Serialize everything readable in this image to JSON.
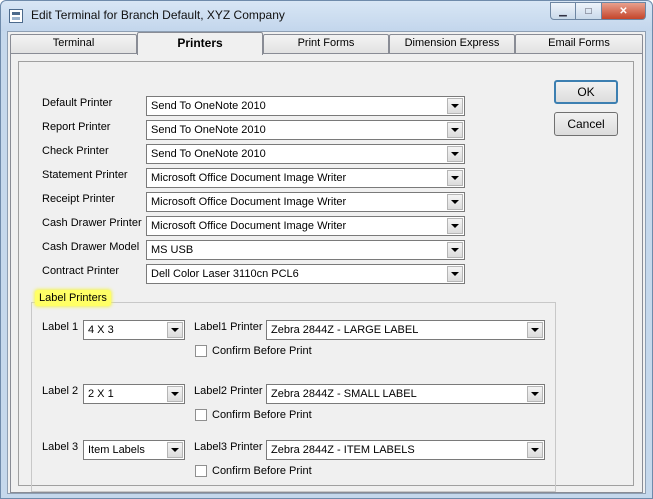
{
  "window": {
    "title": "Edit Terminal  for Branch Default, XYZ Company",
    "minimize_glyph": "▁",
    "maximize_glyph": "□",
    "close_glyph": "✕"
  },
  "tabs": [
    {
      "label": "Terminal"
    },
    {
      "label": "Printers"
    },
    {
      "label": "Print Forms"
    },
    {
      "label": "Dimension Express"
    },
    {
      "label": "Email Forms"
    }
  ],
  "printers": [
    {
      "label": "Default Printer",
      "value": "Send To OneNote 2010"
    },
    {
      "label": "Report Printer",
      "value": "Send To OneNote 2010"
    },
    {
      "label": "Check Printer",
      "value": "Send To OneNote 2010"
    },
    {
      "label": "Statement Printer",
      "value": "Microsoft Office Document Image Writer"
    },
    {
      "label": "Receipt Printer",
      "value": "Microsoft Office Document Image Writer"
    },
    {
      "label": "Cash Drawer Printer",
      "value": "Microsoft Office Document Image Writer"
    },
    {
      "label": "Cash Drawer Model",
      "value": "MS USB"
    },
    {
      "label": "Contract Printer",
      "value": "Dell Color Laser 3110cn PCL6"
    }
  ],
  "buttons": {
    "ok": "OK",
    "cancel": "Cancel"
  },
  "label_printers": {
    "group_title": "Label Printers",
    "rows": [
      {
        "label": "Label 1",
        "size": "4 X 3",
        "printer_label": "Label1 Printer",
        "printer": "Zebra 2844Z - LARGE LABEL",
        "confirm_label": "Confirm Before Print",
        "confirm_checked": false
      },
      {
        "label": "Label 2",
        "size": "2 X 1",
        "printer_label": "Label2 Printer",
        "printer": "Zebra 2844Z - SMALL LABEL",
        "confirm_label": "Confirm Before Print",
        "confirm_checked": false
      },
      {
        "label": "Label 3",
        "size": "Item Labels",
        "printer_label": "Label3 Printer",
        "printer": "Zebra 2844Z - ITEM LABELS",
        "confirm_label": "Confirm Before Print",
        "confirm_checked": false
      }
    ]
  }
}
